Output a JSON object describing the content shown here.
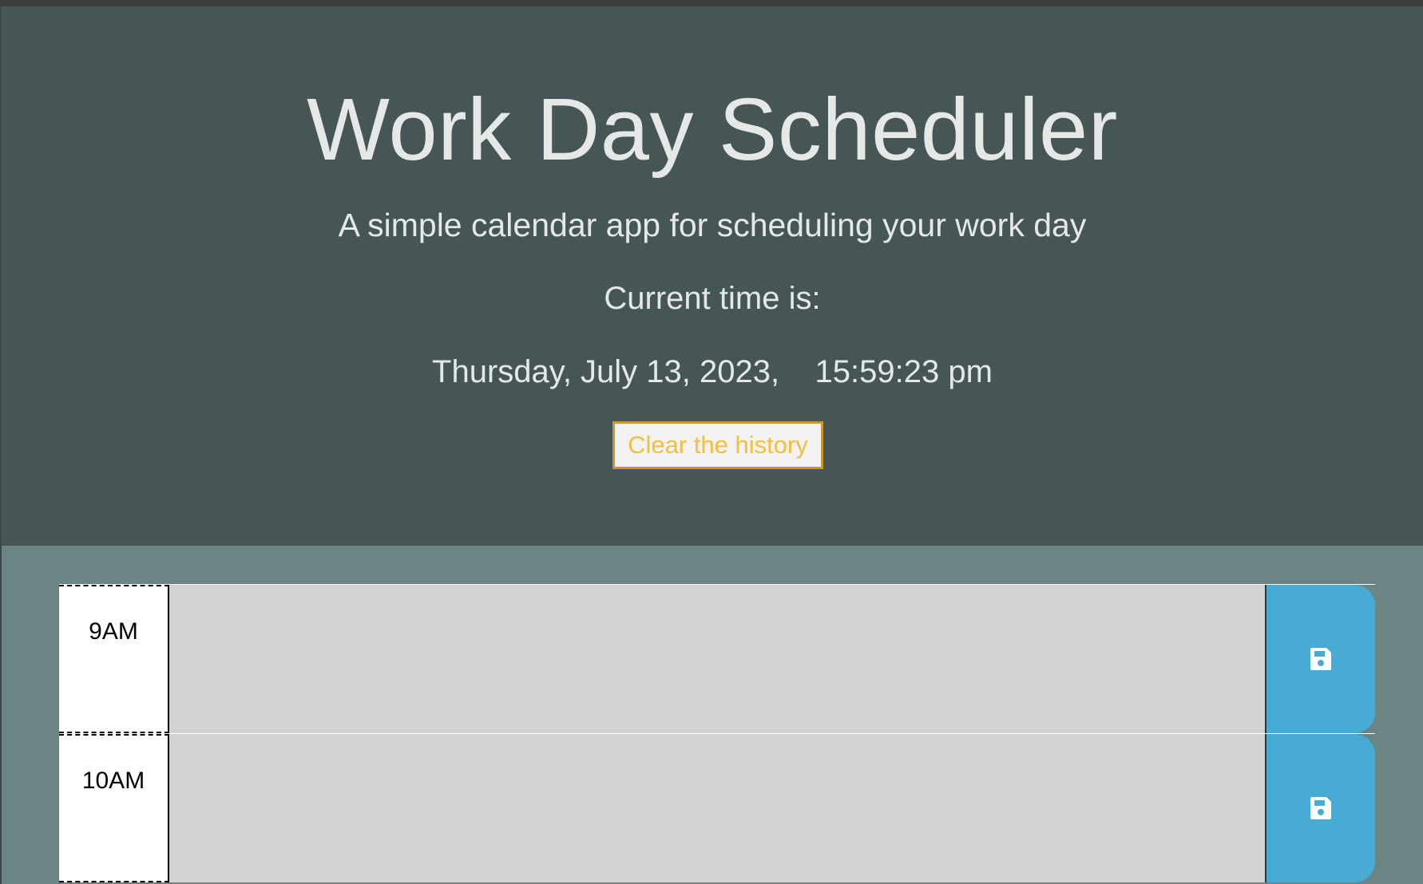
{
  "header": {
    "title": "Work Day Scheduler",
    "subtitle": "A simple calendar app for scheduling your work day",
    "time_label": "Current time is:",
    "current_time": "Thursday, July 13, 2023,    15:59:23 pm",
    "clear_button_label": "Clear the history"
  },
  "time_blocks": [
    {
      "hour": "9AM",
      "text": "",
      "save_icon": "floppy-disk-icon"
    },
    {
      "hour": "10AM",
      "text": "",
      "save_icon": "floppy-disk-icon"
    }
  ],
  "colors": {
    "header_bg": "#465656",
    "page_bg": "#6b8585",
    "block_bg": "#d3d3d3",
    "save_bg": "#47abd4",
    "clear_button_text": "#f0c040",
    "clear_button_border": "#c9962e"
  }
}
